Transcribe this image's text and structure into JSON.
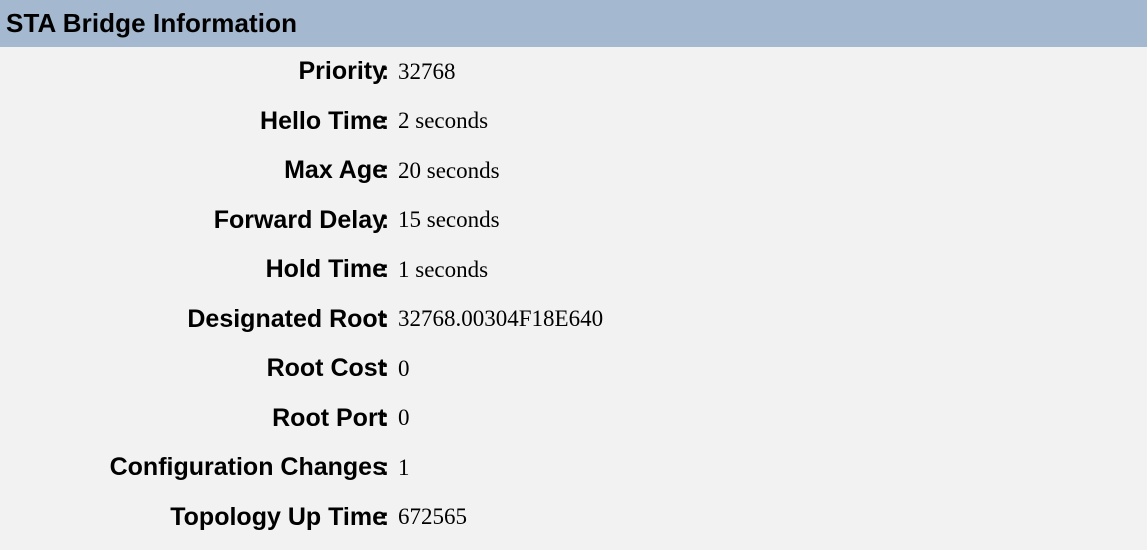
{
  "panel": {
    "title": "STA Bridge Information",
    "header_color": "#a4b8cf",
    "body_color": "#f2f2f2"
  },
  "rows": [
    {
      "label": "Priority",
      "separator": ":",
      "value": "32768"
    },
    {
      "label": "Hello Time",
      "separator": ":",
      "value": "2 seconds"
    },
    {
      "label": "Max Age",
      "separator": ":",
      "value": "20 seconds"
    },
    {
      "label": "Forward Delay",
      "separator": ":",
      "value": "15 seconds"
    },
    {
      "label": "Hold Time",
      "separator": ":",
      "value": "1 seconds"
    },
    {
      "label": "Designated Root",
      "separator": ":",
      "value": "32768.00304F18E640"
    },
    {
      "label": "Root Cost",
      "separator": ":",
      "value": "0"
    },
    {
      "label": "Root Port",
      "separator": ":",
      "value": "0"
    },
    {
      "label": "Configuration Changes",
      "separator": ":",
      "value": "1"
    },
    {
      "label": "Topology Up Time",
      "separator": ":",
      "value": "672565"
    }
  ]
}
